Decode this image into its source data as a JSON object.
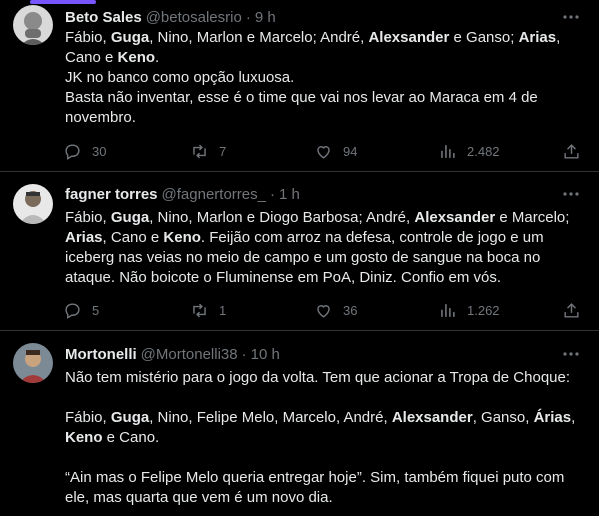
{
  "tweets": [
    {
      "name": "Beto Sales",
      "handle": "@betosalesrio",
      "time": "9 h",
      "paragraphs": [
        [
          [
            "Fábio, ",
            false
          ],
          [
            "Guga",
            true
          ],
          [
            ", Nino, Marlon e Marcelo; André, ",
            false
          ],
          [
            "Alexsander",
            true
          ],
          [
            " e Ganso; ",
            false
          ],
          [
            "Arias",
            true
          ],
          [
            ",",
            false
          ]
        ],
        [
          [
            "Cano e ",
            false
          ],
          [
            "Keno",
            true
          ],
          [
            ".",
            false
          ]
        ],
        [
          [
            "JK no banco como opção luxuosa.",
            false
          ]
        ],
        [
          [
            "Basta não inventar, esse é o time que vai nos levar ao Maraca em 4 de",
            false
          ]
        ],
        [
          [
            "novembro.",
            false
          ]
        ]
      ],
      "replies": "30",
      "retweets": "7",
      "likes": "94",
      "views": "2.482"
    },
    {
      "name": "fagner torres",
      "handle": "@fagnertorres_",
      "time": "1 h",
      "paragraphs": [
        [
          [
            "Fábio, ",
            false
          ],
          [
            "Guga",
            true
          ],
          [
            ", Nino, Marlon e Diogo Barbosa; André, ",
            false
          ],
          [
            "Alexsander",
            true
          ],
          [
            " e Marcelo;",
            false
          ]
        ],
        [
          [
            "Arias",
            true
          ],
          [
            ", Cano e ",
            false
          ],
          [
            "Keno",
            true
          ],
          [
            ". Feijão com arroz na defesa, controle de jogo e um",
            false
          ]
        ],
        [
          [
            "iceberg nas veias no meio de campo e um gosto de sangue na boca no",
            false
          ]
        ],
        [
          [
            "ataque. Não boicote o Fluminense em PoA, Diniz. Confio em vós.",
            false
          ]
        ]
      ],
      "replies": "5",
      "retweets": "1",
      "likes": "36",
      "views": "1.262"
    },
    {
      "name": "Mortonelli",
      "handle": "@Mortonelli38",
      "time": "10 h",
      "paragraphs": [
        [
          [
            "Não tem mistério para o jogo da volta. Tem que acionar a Tropa de Choque:",
            false
          ]
        ],
        [],
        [
          [
            "Fábio, ",
            false
          ],
          [
            "Guga",
            true
          ],
          [
            ", Nino, Felipe Melo, Marcelo, André, ",
            false
          ],
          [
            "Alexsander",
            true
          ],
          [
            ", Ganso, ",
            false
          ],
          [
            "Árias",
            true
          ],
          [
            ",",
            false
          ]
        ],
        [
          [
            "Keno",
            true
          ],
          [
            " e Cano.",
            false
          ]
        ],
        [],
        [
          [
            "“Ain mas o Felipe Melo queria entregar hoje”. Sim, também fiquei puto com",
            false
          ]
        ],
        [
          [
            "ele, mas quarta que vem é um novo dia.",
            false
          ]
        ]
      ]
    }
  ],
  "icons": {
    "more": "more-icon",
    "reply": "reply-icon",
    "retweet": "retweet-icon",
    "like": "like-icon",
    "views": "views-icon",
    "share": "share-icon"
  },
  "colors": {
    "background": "#000000",
    "text": "#e7e9ea",
    "secondary": "#71767b",
    "divider": "#2f3336",
    "accent": "#7856ff"
  }
}
